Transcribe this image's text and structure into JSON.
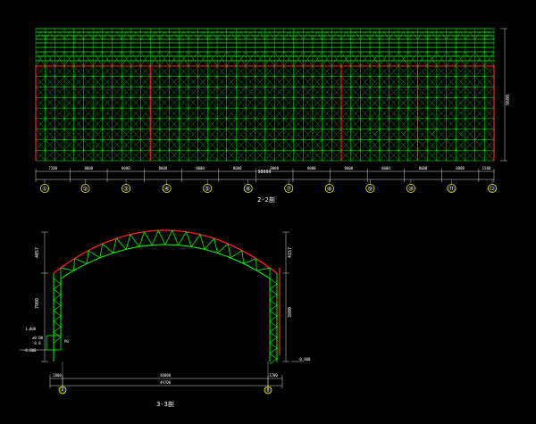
{
  "colors": {
    "background": "#000000",
    "truss": "#00ff00",
    "column": "#ff2020",
    "dimension": "#d8d8d8",
    "axis_bubble": "#ffff00",
    "text": "#ffffff"
  },
  "elevation": {
    "title": "2-2剖",
    "axis_labels": [
      "①",
      "②",
      "③",
      "④",
      "⑤",
      "⑥",
      "⑦",
      "⑧",
      "⑨",
      "⑩",
      "⑪",
      "⑫"
    ],
    "span_dims": [
      "7200",
      "8000",
      "8000",
      "8000",
      "8000",
      "8000",
      "8000",
      "8000",
      "8000",
      "8000",
      "8000",
      "8000",
      "1500"
    ],
    "total_dim": "98000",
    "height_dim": "9600",
    "bays": 12
  },
  "section": {
    "title": "3-3剖",
    "axis_labels": [
      "Ⓐ",
      "Ⓑ"
    ],
    "span_dim": "48000",
    "total_dim": "49700",
    "left_edge_dim": "2000",
    "right_edge_dim": "1700",
    "left_rise_dim": "4057",
    "left_wall_dim": "7900",
    "right_rise_dim": "4157",
    "right_wall_dim": "3800",
    "level_left_top": "1.000",
    "level_left_mid": "±0.00",
    "level_left_low": "-0.8",
    "level_left_base": "-0.800",
    "level_right": "-0.800",
    "detail_note": "P0"
  }
}
